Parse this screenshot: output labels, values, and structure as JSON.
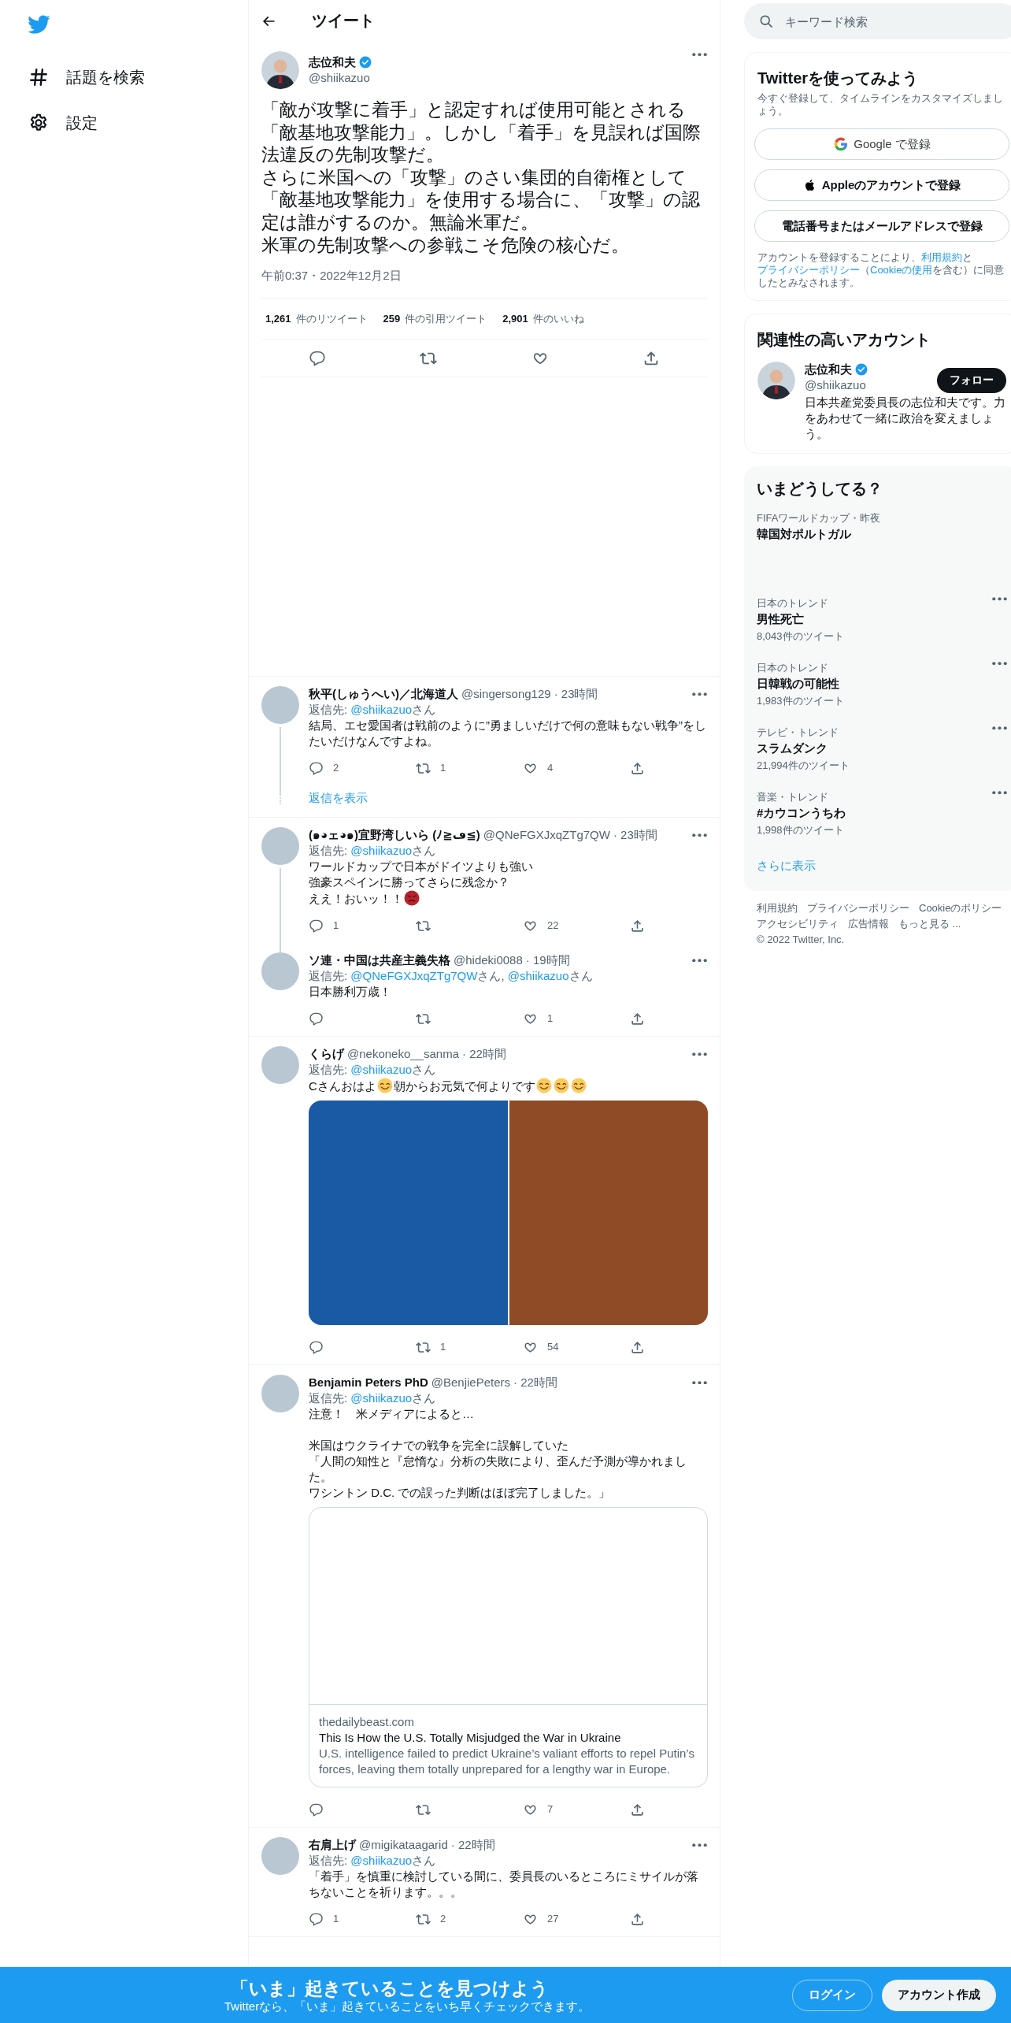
{
  "nav": {
    "items": [
      {
        "label": "話題を検索"
      },
      {
        "label": "設定"
      }
    ]
  },
  "header": {
    "title": "ツイート"
  },
  "tweet": {
    "name": "志位和夫",
    "verified": true,
    "handle": "@shiikazuo",
    "paragraphs": [
      "「敵が攻撃に着手」と認定すれば使用可能とされる「敵基地攻撃能力」。しかし「着手」を見誤れば国際法違反の先制攻撃だ。",
      "さらに米国への「攻撃」のさい集団的自衛権として「敵基地攻撃能力」を使用する場合に、「攻撃」の認定は誰がするのか。無論米軍だ。",
      "米軍の先制攻撃への参戦こそ危険の核心だ。"
    ],
    "timestamp": "午前0:37・2022年12月2日",
    "stats": [
      {
        "count": "1,261",
        "label": "件のリツイート"
      },
      {
        "count": "259",
        "label": "件の引用ツイート"
      },
      {
        "count": "2,901",
        "label": "件のいいね"
      }
    ]
  },
  "replies": [
    {
      "name": "秋平(しゅうへい)／北海道人",
      "handle": "@singersong129",
      "time": "· 23時間",
      "reply_to": [
        {
          "kind": "text",
          "text": "返信先: "
        },
        {
          "kind": "link",
          "text": "@shiikazuo"
        },
        {
          "kind": "text",
          "text": "さん"
        }
      ],
      "body": [
        {
          "kind": "line",
          "parts": [
            {
              "kind": "text",
              "text": "結局、エセ愛国者は戦前のように”勇ましいだけで何の意味もない戦争”をしたいだけなんですよね。"
            }
          ]
        }
      ],
      "replies": "2",
      "retweets": "1",
      "likes": "4",
      "connected": false,
      "show_replies": "返信を表示"
    },
    {
      "name": "(๑◕ェ◕๑)宜野湾しいら (ﾉ≧ڡ≦)",
      "handle": "@QNeFGXJxqZTg7QW",
      "time": "· 23時間",
      "reply_to": [
        {
          "kind": "text",
          "text": "返信先: "
        },
        {
          "kind": "link",
          "text": "@shiikazuo"
        },
        {
          "kind": "text",
          "text": "さん"
        }
      ],
      "body": [
        {
          "kind": "line",
          "parts": [
            {
              "kind": "text",
              "text": "ワールドカップで日本がドイツよりも強い"
            }
          ]
        },
        {
          "kind": "line",
          "parts": [
            {
              "kind": "text",
              "text": "強豪スペインに勝ってさらに残念か？"
            }
          ]
        },
        {
          "kind": "line",
          "parts": [
            {
              "kind": "text",
              "text": "ええ！おいッ！！"
            },
            {
              "kind": "angry-emoji"
            }
          ]
        }
      ],
      "replies": "1",
      "likes": "22",
      "connected": true
    },
    {
      "name": "ソ連・中国は共産主義失格",
      "handle": "@hideki0088",
      "time": "· 19時間",
      "reply_to": [
        {
          "kind": "text",
          "text": "返信先: "
        },
        {
          "kind": "link",
          "text": "@QNeFGXJxqZTg7QW"
        },
        {
          "kind": "text",
          "text": "さん, "
        },
        {
          "kind": "link",
          "text": "@shiikazuo"
        },
        {
          "kind": "text",
          "text": "さん"
        }
      ],
      "body": [
        {
          "kind": "line",
          "parts": [
            {
              "kind": "text",
              "text": "日本勝利万歳！"
            }
          ]
        }
      ],
      "likes": "1",
      "connected": false
    },
    {
      "name": "くらげ",
      "handle": "@nekoneko__sanma",
      "time": "· 22時間",
      "reply_to": [
        {
          "kind": "text",
          "text": "返信先: "
        },
        {
          "kind": "link",
          "text": "@shiikazuo"
        },
        {
          "kind": "text",
          "text": "さん"
        }
      ],
      "body": [
        {
          "kind": "line",
          "parts": [
            {
              "kind": "text",
              "text": "Cさんおはよ"
            },
            {
              "kind": "smiling-emoji"
            },
            {
              "kind": "text",
              "text": "朝からお元気で何よりです"
            },
            {
              "kind": "smiling-emoji"
            },
            {
              "kind": "smiling-emoji"
            },
            {
              "kind": "smiling-emoji"
            }
          ]
        }
      ],
      "media": [
        {
          "color": "#1a5aa5"
        },
        {
          "color": "#8f4b26"
        }
      ],
      "retweets": "1",
      "likes": "54",
      "connected": false
    },
    {
      "name": "Benjamin Peters PhD",
      "handle": "@BenjiePeters",
      "time": "· 22時間",
      "reply_to": [
        {
          "kind": "text",
          "text": "返信先: "
        },
        {
          "kind": "link",
          "text": "@shiikazuo"
        },
        {
          "kind": "text",
          "text": "さん"
        }
      ],
      "body": [
        {
          "kind": "line",
          "parts": [
            {
              "kind": "text",
              "text": "注意！　米メディアによると…"
            }
          ]
        },
        {
          "kind": "blank"
        },
        {
          "kind": "line",
          "parts": [
            {
              "kind": "text",
              "text": "米国はウクライナでの戦争を完全に誤解していた"
            }
          ]
        },
        {
          "kind": "line",
          "parts": [
            {
              "kind": "text",
              "text": "「人間の知性と『怠惰な』分析の失敗により、歪んだ予測が導かれました。"
            }
          ]
        },
        {
          "kind": "line",
          "parts": [
            {
              "kind": "text",
              "text": "ワシントン D.C. での誤った判断はほぼ完了しました。」"
            }
          ]
        }
      ],
      "card": {
        "domain": "thedailybeast.com",
        "title": "This Is How the U.S. Totally Misjudged the War in Ukraine",
        "description": "U.S. intelligence failed to predict Ukraine’s valiant efforts to repel Putin’s forces, leaving them totally unprepared for a lengthy war in Europe."
      },
      "likes": "7",
      "connected": false
    },
    {
      "name": "右肩上げ",
      "handle": "@migikataagarid",
      "time": "· 22時間",
      "reply_to": [
        {
          "kind": "text",
          "text": "返信先: "
        },
        {
          "kind": "link",
          "text": "@shiikazuo"
        },
        {
          "kind": "text",
          "text": "さん"
        }
      ],
      "body": [
        {
          "kind": "line",
          "parts": [
            {
              "kind": "text",
              "text": "「着手」を慎重に検討している間に、委員長のいるところにミサイルが落ちないことを祈ります。。。"
            }
          ]
        }
      ],
      "replies": "1",
      "retweets": "2",
      "likes": "27",
      "connected": false
    }
  ],
  "sidebar": {
    "search": {
      "placeholder": "キーワード検索"
    },
    "signup": {
      "title": "Twitterを使ってみよう",
      "subtitle": "今すぐ登録して、タイムラインをカスタマイズしましょう。",
      "buttons": [
        {
          "kind": "google",
          "label": "Google で登録"
        },
        {
          "kind": "apple",
          "label": "Appleのアカウントで登録"
        },
        {
          "kind": "plain",
          "label": "電話番号またはメールアドレスで登録"
        }
      ],
      "legal": [
        {
          "kind": "text",
          "text": "アカウントを登録することにより、"
        },
        {
          "kind": "link",
          "text": "利用規約"
        },
        {
          "kind": "text",
          "text": "と"
        },
        {
          "kind": "link",
          "text": "プライバシーポリシー"
        },
        {
          "kind": "text",
          "text": "（"
        },
        {
          "kind": "link",
          "text": "Cookieの使用"
        },
        {
          "kind": "text",
          "text": "を含む）に同意したとみなされます。"
        }
      ]
    },
    "related": {
      "title": "関連性の高いアカウント",
      "accounts": [
        {
          "name": "志位和夫",
          "verified": true,
          "handle": "@shiikazuo",
          "bio": "日本共産党委員長の志位和夫です。力をあわせて一緒に政治を変えましょう。",
          "button": "フォロー"
        }
      ]
    },
    "trends": {
      "title": "いまどうしてる？",
      "items": [
        {
          "category": "FIFAワールドカップ・昨夜",
          "title": "韓国対ポルトガル",
          "menu": false
        },
        {
          "category": "日本のトレンド",
          "title": "男性死亡",
          "count": "8,043件のツイート",
          "menu": true
        },
        {
          "category": "日本のトレンド",
          "title": "日韓戦の可能性",
          "count": "1,983件のツイート",
          "menu": true
        },
        {
          "category": "テレビ・トレンド",
          "title": "スラムダンク",
          "count": "21,994件のツイート",
          "menu": true
        },
        {
          "category": "音楽・トレンド",
          "title": "#カウコンうちわ",
          "count": "1,998件のツイート",
          "menu": true
        }
      ],
      "more": "さらに表示"
    },
    "footer": {
      "links": [
        "利用規約",
        "プライバシーポリシー",
        "Cookieのポリシー",
        "アクセシビリティ",
        "広告情報",
        "もっと見る ..."
      ],
      "copyright": "© 2022 Twitter, Inc."
    }
  },
  "banner": {
    "title": "「いま」起きていることを見つけよう",
    "subtitle": "Twitterなら、「いま」起きていることをいち早くチェックできます。",
    "buttons": [
      {
        "kind": "outline",
        "label": "ログイン"
      },
      {
        "kind": "filled",
        "label": "アカウント作成"
      }
    ]
  }
}
